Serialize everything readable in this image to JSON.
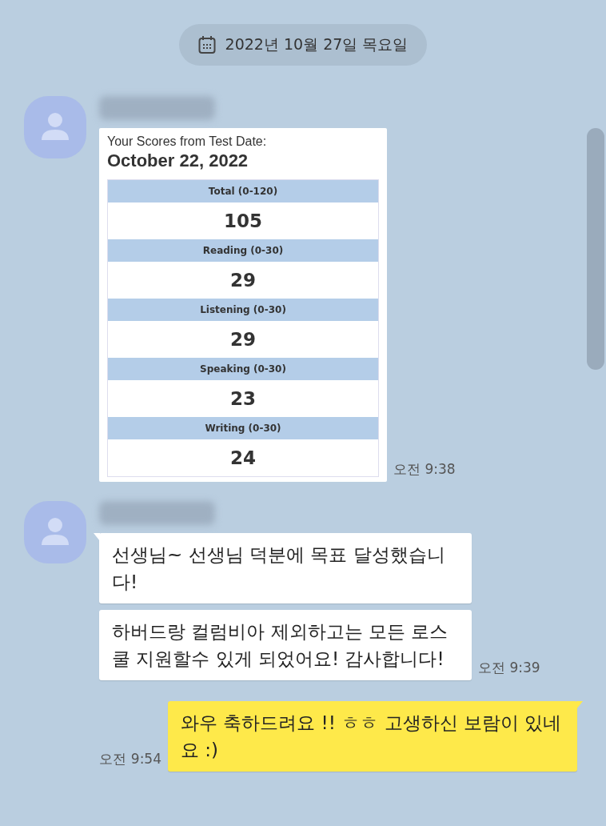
{
  "date_divider": {
    "text": "2022년 10월 27일 목요일"
  },
  "messages": [
    {
      "kind": "image",
      "from_me": false,
      "card": {
        "heading": "Your Scores from Test Date:",
        "date": "October 22, 2022",
        "scores": [
          {
            "label": "Total (0-120)",
            "score": "105"
          },
          {
            "label": "Reading (0-30)",
            "score": "29"
          },
          {
            "label": "Listening (0-30)",
            "score": "29"
          },
          {
            "label": "Speaking (0-30)",
            "score": "23"
          },
          {
            "label": "Writing (0-30)",
            "score": "24"
          }
        ]
      },
      "time": "오전 9:38"
    },
    {
      "kind": "text",
      "from_me": false,
      "bubbles": [
        "선생님~ 선생님 덕분에 목표 달성했습니다!",
        "하버드랑 컬럼비아 제외하고는 모든 로스쿨 지원할수 있게 되었어요! 감사합니다!"
      ],
      "time": "오전 9:39"
    },
    {
      "kind": "text",
      "from_me": true,
      "bubbles": [
        "와우 축하드려요 !! ㅎㅎ 고생하신 보람이 있네요 :)"
      ],
      "time": "오전 9:54"
    }
  ]
}
